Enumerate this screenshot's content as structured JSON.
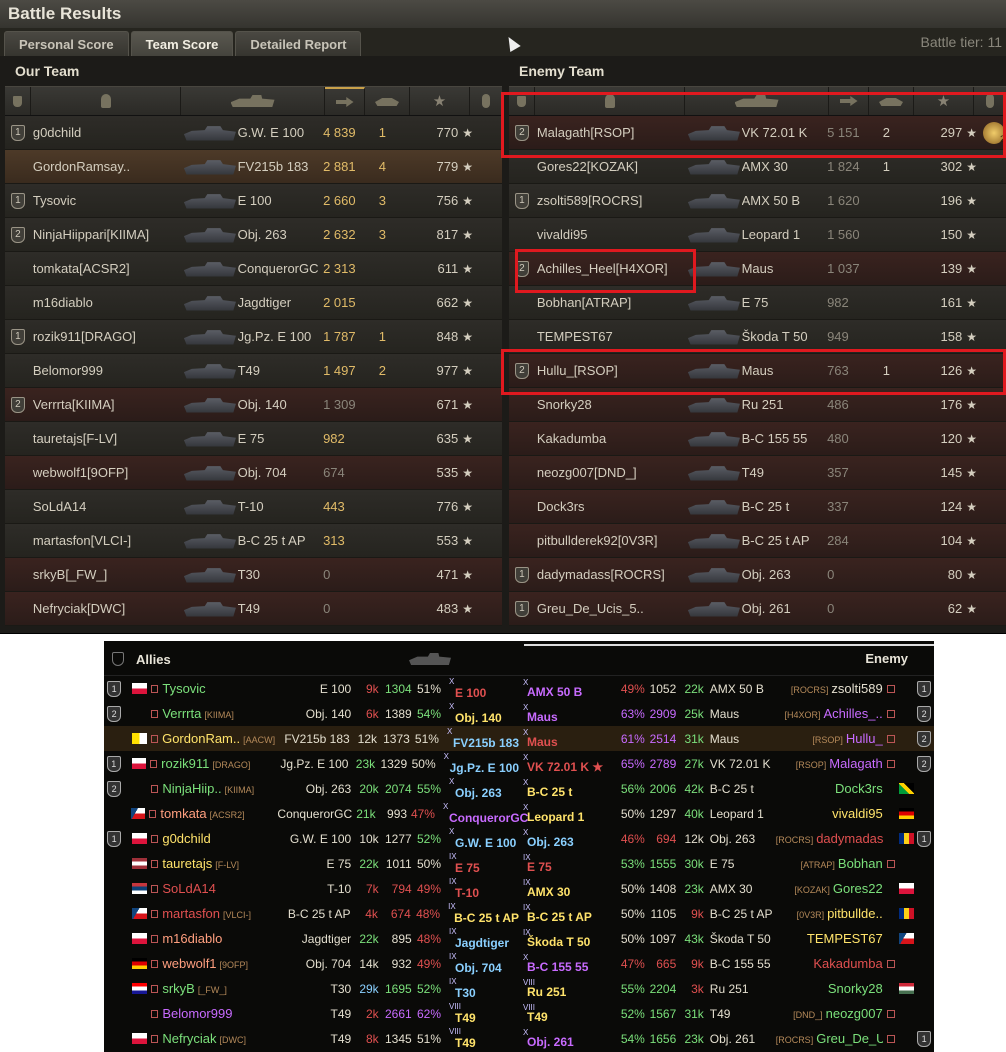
{
  "window": {
    "title": "Battle Results",
    "tier": "Battle tier: 11"
  },
  "tabs": [
    "Personal Score",
    "Team Score",
    "Detailed Report"
  ],
  "our_team": {
    "title": "Our Team",
    "players": [
      {
        "badge": "1",
        "name": "g0dchild",
        "tank": "G.W. E 100",
        "dmg": "4 839",
        "kills": "1",
        "xp": "770",
        "style": "normal",
        "dmgstyle": "gold"
      },
      {
        "badge": "",
        "name": "GordonRamsay..",
        "tank": "FV215b 183",
        "dmg": "2 881",
        "kills": "4",
        "xp": "779",
        "style": "self",
        "dmgstyle": "gold"
      },
      {
        "badge": "1",
        "name": "Tysovic",
        "tank": "E 100",
        "dmg": "2 660",
        "kills": "3",
        "xp": "756",
        "style": "normal",
        "dmgstyle": "gold"
      },
      {
        "badge": "2",
        "name": "NinjaHiippari[KIIMA]",
        "tank": "Obj. 263",
        "dmg": "2 632",
        "kills": "3",
        "xp": "817",
        "style": "normal",
        "dmgstyle": "gold"
      },
      {
        "badge": "",
        "name": "tomkata[ACSR2]",
        "tank": "ConquerorGC",
        "dmg": "2 313",
        "kills": "",
        "xp": "611",
        "style": "normal",
        "dmgstyle": "gold"
      },
      {
        "badge": "",
        "name": "m16diablo",
        "tank": "Jagdtiger",
        "dmg": "2 015",
        "kills": "",
        "xp": "662",
        "style": "normal",
        "dmgstyle": "gold"
      },
      {
        "badge": "1",
        "name": "rozik911[DRAGO]",
        "tank": "Jg.Pz. E 100",
        "dmg": "1 787",
        "kills": "1",
        "xp": "848",
        "style": "normal",
        "dmgstyle": "gold"
      },
      {
        "badge": "",
        "name": "Belomor999",
        "tank": "T49",
        "dmg": "1 497",
        "kills": "2",
        "xp": "977",
        "style": "normal",
        "dmgstyle": "gold"
      },
      {
        "badge": "2",
        "name": "Verrrta[KIIMA]",
        "tank": "Obj. 140",
        "dmg": "1 309",
        "kills": "",
        "xp": "671",
        "style": "dark",
        "dmgstyle": "gray"
      },
      {
        "badge": "",
        "name": "tauretajs[F-LV]",
        "tank": "E 75",
        "dmg": "982",
        "kills": "",
        "xp": "635",
        "style": "normal",
        "dmgstyle": "gold"
      },
      {
        "badge": "",
        "name": "webwolf1[9OFP]",
        "tank": "Obj. 704",
        "dmg": "674",
        "kills": "",
        "xp": "535",
        "style": "dark",
        "dmgstyle": "gray"
      },
      {
        "badge": "",
        "name": "SoLdA14",
        "tank": "T-10",
        "dmg": "443",
        "kills": "",
        "xp": "776",
        "style": "normal",
        "dmgstyle": "gold"
      },
      {
        "badge": "",
        "name": "martasfon[VLCI-]",
        "tank": "B-C 25 t AP",
        "dmg": "313",
        "kills": "",
        "xp": "553",
        "style": "normal",
        "dmgstyle": "gold"
      },
      {
        "badge": "",
        "name": "srkyB[_FW_]",
        "tank": "T30",
        "dmg": "0",
        "kills": "",
        "xp": "471",
        "style": "dark",
        "dmgstyle": "gray"
      },
      {
        "badge": "",
        "name": "Nefryciak[DWC]",
        "tank": "T49",
        "dmg": "0",
        "kills": "",
        "xp": "483",
        "style": "dark",
        "dmgstyle": "gray"
      }
    ]
  },
  "enemy_team": {
    "title": "Enemy Team",
    "players": [
      {
        "badge": "2",
        "name": "Malagath[RSOP]",
        "tank": "VK 72.01 K",
        "dmg": "5 151",
        "kills": "2",
        "xp": "297",
        "style": "dark",
        "medal": "2"
      },
      {
        "badge": "",
        "name": "Gores22[KOZAK]",
        "tank": "AMX 30",
        "dmg": "1 824",
        "kills": "1",
        "xp": "302",
        "style": "normal"
      },
      {
        "badge": "1",
        "name": "zsolti589[ROCRS]",
        "tank": "AMX 50 B",
        "dmg": "1 620",
        "kills": "",
        "xp": "196",
        "style": "normal"
      },
      {
        "badge": "",
        "name": "vivaldi95",
        "tank": "Leopard 1",
        "dmg": "1 560",
        "kills": "",
        "xp": "150",
        "style": "normal"
      },
      {
        "badge": "2",
        "name": "Achilles_Heel[H4XOR]",
        "tank": "Maus",
        "dmg": "1 037",
        "kills": "",
        "xp": "139",
        "style": "dark"
      },
      {
        "badge": "",
        "name": "Bobhan[ATRAP]",
        "tank": "E 75",
        "dmg": "982",
        "kills": "",
        "xp": "161",
        "style": "normal"
      },
      {
        "badge": "",
        "name": "TEMPEST67",
        "tank": "Škoda T 50",
        "dmg": "949",
        "kills": "",
        "xp": "158",
        "style": "normal"
      },
      {
        "badge": "2",
        "name": "Hullu_[RSOP]",
        "tank": "Maus",
        "dmg": "763",
        "kills": "1",
        "xp": "126",
        "style": "dark"
      },
      {
        "badge": "",
        "name": "Snorky28",
        "tank": "Ru 251",
        "dmg": "486",
        "kills": "",
        "xp": "176",
        "style": "dark"
      },
      {
        "badge": "",
        "name": "Kakadumba",
        "tank": "B-C 155 55",
        "dmg": "480",
        "kills": "",
        "xp": "120",
        "style": "dark"
      },
      {
        "badge": "",
        "name": "neozg007[DND_]",
        "tank": "T49",
        "dmg": "357",
        "kills": "",
        "xp": "145",
        "style": "dark"
      },
      {
        "badge": "",
        "name": "Dock3rs",
        "tank": "B-C 25 t",
        "dmg": "337",
        "kills": "",
        "xp": "124",
        "style": "dark"
      },
      {
        "badge": "",
        "name": "pitbullderek92[0V3R]",
        "tank": "B-C 25 t AP",
        "dmg": "284",
        "kills": "",
        "xp": "104",
        "style": "dark"
      },
      {
        "badge": "1",
        "name": "dadymadass[ROCRS]",
        "tank": "Obj. 263",
        "dmg": "0",
        "kills": "",
        "xp": "80",
        "style": "dark"
      },
      {
        "badge": "1",
        "name": "Greu_De_Ucis_5..",
        "tank": "Obj. 261",
        "dmg": "0",
        "kills": "",
        "xp": "62",
        "style": "dark"
      }
    ]
  },
  "xvm": {
    "allies_label": "Allies",
    "enemy_label": "Enemy",
    "rows": [
      {
        "lb": "1",
        "lflag": "pl",
        "lname": "Tysovic",
        "lclan": "",
        "lcolor": "#7be07b",
        "ltank": "E 100",
        "ldmg": "9k",
        "ldc": "#e05050",
        "lwn": "1304",
        "lwc": "#7be07b",
        "lpct": "51%",
        "lpc": "#e4dfcf",
        "ct": "X",
        "cl": "E 100",
        "clc": "#e05050",
        "crt": "X",
        "crl": "AMX 50 B",
        "crc": "#c86bff",
        "rpct": "49%",
        "rpc": "#e05050",
        "rwn": "1052",
        "rwc": "#e4dfcf",
        "rdmg": "22k",
        "rdc": "#7be07b",
        "rtank": "AMX 50 B",
        "rclan": "[ROCRS]",
        "rname": "zsolti589",
        "rcolor": "#e4dfcf",
        "rflag": "",
        "rb": "1"
      },
      {
        "lb": "2",
        "lflag": "",
        "lname": "Verrrta",
        "lclan": "[KIIMA]",
        "lcolor": "#7be07b",
        "ltank": "Obj. 140",
        "ldmg": "6k",
        "ldc": "#e05050",
        "lwn": "1389",
        "lwc": "#e4dfcf",
        "lpct": "54%",
        "lpc": "#7be07b",
        "ct": "X",
        "cl": "Obj. 140",
        "clc": "#ffe36b",
        "crt": "X",
        "crl": "Maus",
        "crc": "#c86bff",
        "rpct": "63%",
        "rpc": "#c86bff",
        "rwn": "2909",
        "rwc": "#c86bff",
        "rdmg": "25k",
        "rdc": "#7be07b",
        "rtank": "Maus",
        "rclan": "[H4XOR]",
        "rname": "Achilles_..",
        "rcolor": "#c86bff",
        "rflag": "",
        "rb": "2"
      },
      {
        "lb": "",
        "lflag": "va",
        "lname": "GordonRam..",
        "lclan": "[AACW]",
        "lcolor": "#ffe36b",
        "ltank": "FV215b 183",
        "ldmg": "12k",
        "ldc": "#e4dfcf",
        "lwn": "1373",
        "lwc": "#e4dfcf",
        "lpct": "51%",
        "lpc": "#e4dfcf",
        "ct": "X",
        "cl": "FV215b 183",
        "clc": "#8ad0ff",
        "crt": "X",
        "crl": "Maus",
        "crc": "#e05050",
        "rpct": "61%",
        "rpc": "#c86bff",
        "rwn": "2514",
        "rwc": "#c86bff",
        "rdmg": "31k",
        "rdc": "#7be07b",
        "rtank": "Maus",
        "rclan": "[RSOP]",
        "rname": "Hullu_",
        "rcolor": "#c86bff",
        "rflag": "",
        "rb": "2",
        "hl": true
      },
      {
        "lb": "1",
        "lflag": "pl",
        "lname": "rozik911",
        "lclan": "[DRAGO]",
        "lcolor": "#7be07b",
        "ltank": "Jg.Pz. E 100",
        "ldmg": "23k",
        "ldc": "#7be07b",
        "lwn": "1329",
        "lwc": "#e4dfcf",
        "lpct": "50%",
        "lpc": "#e4dfcf",
        "ct": "X",
        "cl": "Jg.Pz. E 100",
        "clc": "#8ad0ff",
        "crt": "X",
        "crl": "VK 72.01 K ★",
        "crc": "#e05050",
        "rpct": "65%",
        "rpc": "#c86bff",
        "rwn": "2789",
        "rwc": "#c86bff",
        "rdmg": "27k",
        "rdc": "#7be07b",
        "rtank": "VK 72.01 K",
        "rclan": "[RSOP]",
        "rname": "Malagath",
        "rcolor": "#c86bff",
        "rflag": "",
        "rb": "2"
      },
      {
        "lb": "2",
        "lflag": "",
        "lname": "NinjaHiip..",
        "lclan": "[KIIMA]",
        "lcolor": "#7be07b",
        "ltank": "Obj. 263",
        "ldmg": "20k",
        "ldc": "#7be07b",
        "lwn": "2074",
        "lwc": "#7be07b",
        "lpct": "55%",
        "lpc": "#7be07b",
        "ct": "X",
        "cl": "Obj. 263",
        "clc": "#8ad0ff",
        "crt": "X",
        "crl": "B-C 25 t",
        "crc": "#ffe36b",
        "rpct": "56%",
        "rpc": "#7be07b",
        "rwn": "2006",
        "rwc": "#7be07b",
        "rdmg": "42k",
        "rdc": "#7be07b",
        "rtank": "B-C 25 t",
        "rclan": "",
        "rname": "Dock3rs",
        "rcolor": "#7be07b",
        "rflag": "jm",
        "rb": ""
      },
      {
        "lb": "",
        "lflag": "cz",
        "lname": "tomkata",
        "lclan": "[ACSR2]",
        "lcolor": "#ff9f7f",
        "ltank": "ConquerorGC",
        "ldmg": "21k",
        "ldc": "#7be07b",
        "lwn": "993",
        "lwc": "#e4dfcf",
        "lpct": "47%",
        "lpc": "#e05050",
        "ct": "X",
        "cl": "ConquerorGC",
        "clc": "#c86bff",
        "crt": "X",
        "crl": "Leopard 1",
        "crc": "#ffe36b",
        "rpct": "50%",
        "rpc": "#e4dfcf",
        "rwn": "1297",
        "rwc": "#e4dfcf",
        "rdmg": "40k",
        "rdc": "#7be07b",
        "rtank": "Leopard 1",
        "rclan": "",
        "rname": "vivaldi95",
        "rcolor": "#ffe36b",
        "rflag": "de",
        "rb": ""
      },
      {
        "lb": "1",
        "lflag": "pl",
        "lname": "g0dchild",
        "lclan": "",
        "lcolor": "#ffe36b",
        "ltank": "G.W. E 100",
        "ldmg": "10k",
        "ldc": "#e4dfcf",
        "lwn": "1277",
        "lwc": "#e4dfcf",
        "lpct": "52%",
        "lpc": "#7be07b",
        "ct": "X",
        "cl": "G.W. E 100",
        "clc": "#8ad0ff",
        "crt": "X",
        "crl": "Obj. 263",
        "crc": "#8ad0ff",
        "rpct": "46%",
        "rpc": "#e05050",
        "rwn": "694",
        "rwc": "#e05050",
        "rdmg": "12k",
        "rdc": "#e4dfcf",
        "rtank": "Obj. 263",
        "rclan": "[ROCRS]",
        "rname": "dadymadass",
        "rcolor": "#e05050",
        "rflag": "ro",
        "rb": "1"
      },
      {
        "lb": "",
        "lflag": "lv",
        "lname": "tauretajs",
        "lclan": "[F-LV]",
        "lcolor": "#ffe36b",
        "ltank": "E 75",
        "ldmg": "22k",
        "ldc": "#7be07b",
        "lwn": "1011",
        "lwc": "#e4dfcf",
        "lpct": "50%",
        "lpc": "#e4dfcf",
        "ct": "IX",
        "cl": "E 75",
        "clc": "#e05050",
        "crt": "IX",
        "crl": "E 75",
        "crc": "#e05050",
        "rpct": "53%",
        "rpc": "#7be07b",
        "rwn": "1555",
        "rwc": "#7be07b",
        "rdmg": "30k",
        "rdc": "#7be07b",
        "rtank": "E 75",
        "rclan": "[ATRAP]",
        "rname": "Bobhan",
        "rcolor": "#7be07b",
        "rflag": "",
        "rb": ""
      },
      {
        "lb": "",
        "lflag": "rs",
        "lname": "SoLdA14",
        "lclan": "",
        "lcolor": "#e05050",
        "ltank": "T-10",
        "ldmg": "7k",
        "ldc": "#e05050",
        "lwn": "794",
        "lwc": "#e05050",
        "lpct": "49%",
        "lpc": "#e05050",
        "ct": "IX",
        "cl": "T-10",
        "clc": "#e05050",
        "crt": "IX",
        "crl": "AMX 30",
        "crc": "#ffe36b",
        "rpct": "50%",
        "rpc": "#e4dfcf",
        "rwn": "1408",
        "rwc": "#e4dfcf",
        "rdmg": "23k",
        "rdc": "#7be07b",
        "rtank": "AMX 30",
        "rclan": "[KOZAK]",
        "rname": "Gores22",
        "rcolor": "#7be07b",
        "rflag": "pl",
        "rb": ""
      },
      {
        "lb": "",
        "lflag": "cz",
        "lname": "martasfon",
        "lclan": "[VLCI-]",
        "lcolor": "#e05050",
        "ltank": "B-C 25 t AP",
        "ldmg": "4k",
        "ldc": "#e05050",
        "lwn": "674",
        "lwc": "#e05050",
        "lpct": "48%",
        "lpc": "#e05050",
        "ct": "IX",
        "cl": "B-C 25 t AP",
        "clc": "#ffe36b",
        "crt": "IX",
        "crl": "B-C 25 t AP",
        "crc": "#ffe36b",
        "rpct": "50%",
        "rpc": "#e4dfcf",
        "rwn": "1105",
        "rwc": "#e4dfcf",
        "rdmg": "9k",
        "rdc": "#e05050",
        "rtank": "B-C 25 t AP",
        "rclan": "[0V3R]",
        "rname": "pitbullde..",
        "rcolor": "#ffe36b",
        "rflag": "ro",
        "rb": ""
      },
      {
        "lb": "",
        "lflag": "pl",
        "lname": "m16diablo",
        "lclan": "",
        "lcolor": "#ff9f7f",
        "ltank": "Jagdtiger",
        "ldmg": "22k",
        "ldc": "#7be07b",
        "lwn": "895",
        "lwc": "#e4dfcf",
        "lpct": "48%",
        "lpc": "#e05050",
        "ct": "IX",
        "cl": "Jagdtiger",
        "clc": "#8ad0ff",
        "crt": "IX",
        "crl": "Škoda T 50",
        "crc": "#ffe36b",
        "rpct": "50%",
        "rpc": "#e4dfcf",
        "rwn": "1097",
        "rwc": "#e4dfcf",
        "rdmg": "43k",
        "rdc": "#7be07b",
        "rtank": "Škoda T 50",
        "rclan": "",
        "rname": "TEMPEST67",
        "rcolor": "#ffe36b",
        "rflag": "cz",
        "rb": ""
      },
      {
        "lb": "",
        "lflag": "de",
        "lname": "webwolf1",
        "lclan": "[9OFP]",
        "lcolor": "#ff9f7f",
        "ltank": "Obj. 704",
        "ldmg": "14k",
        "ldc": "#e4dfcf",
        "lwn": "932",
        "lwc": "#e4dfcf",
        "lpct": "49%",
        "lpc": "#e05050",
        "ct": "IX",
        "cl": "Obj. 704",
        "clc": "#8ad0ff",
        "crt": "X",
        "crl": "B-C 155 55",
        "crc": "#c86bff",
        "rpct": "47%",
        "rpc": "#e05050",
        "rwn": "665",
        "rwc": "#e05050",
        "rdmg": "9k",
        "rdc": "#e05050",
        "rtank": "B-C 155 55",
        "rclan": "",
        "rname": "Kakadumba",
        "rcolor": "#e05050",
        "rflag": "",
        "rb": ""
      },
      {
        "lb": "",
        "lflag": "hr",
        "lname": "srkyB",
        "lclan": "[_FW_]",
        "lcolor": "#7be07b",
        "ltank": "T30",
        "ldmg": "29k",
        "ldc": "#8ad0ff",
        "lwn": "1695",
        "lwc": "#7be07b",
        "lpct": "52%",
        "lpc": "#7be07b",
        "ct": "IX",
        "cl": "T30",
        "clc": "#8ad0ff",
        "crt": "VIII",
        "crl": "Ru 251",
        "crc": "#ffe36b",
        "rpct": "55%",
        "rpc": "#7be07b",
        "rwn": "2204",
        "rwc": "#7be07b",
        "rdmg": "3k",
        "rdc": "#e05050",
        "rtank": "Ru 251",
        "rclan": "",
        "rname": "Snorky28",
        "rcolor": "#7be07b",
        "rflag": "hu",
        "rb": ""
      },
      {
        "lb": "",
        "lflag": "",
        "lname": "Belomor999",
        "lclan": "",
        "lcolor": "#c86bff",
        "ltank": "T49",
        "ldmg": "2k",
        "ldc": "#e05050",
        "lwn": "2661",
        "lwc": "#c86bff",
        "lpct": "62%",
        "lpc": "#c86bff",
        "ct": "VIII",
        "cl": "T49",
        "clc": "#ffe36b",
        "crt": "VIII",
        "crl": "T49",
        "crc": "#ffe36b",
        "rpct": "52%",
        "rpc": "#7be07b",
        "rwn": "1567",
        "rwc": "#7be07b",
        "rdmg": "31k",
        "rdc": "#7be07b",
        "rtank": "T49",
        "rclan": "[DND_]",
        "rname": "neozg007",
        "rcolor": "#7be07b",
        "rflag": "",
        "rb": ""
      },
      {
        "lb": "",
        "lflag": "pl",
        "lname": "Nefryciak",
        "lclan": "[DWC]",
        "lcolor": "#7be07b",
        "ltank": "T49",
        "ldmg": "8k",
        "ldc": "#e05050",
        "lwn": "1345",
        "lwc": "#e4dfcf",
        "lpct": "51%",
        "lpc": "#e4dfcf",
        "ct": "VIII",
        "cl": "T49",
        "clc": "#ffe36b",
        "crt": "X",
        "crl": "Obj. 261",
        "crc": "#c86bff",
        "rpct": "54%",
        "rpc": "#7be07b",
        "rwn": "1656",
        "rwc": "#7be07b",
        "rdmg": "23k",
        "rdc": "#7be07b",
        "rtank": "Obj. 261",
        "rclan": "[ROCRS]",
        "rname": "Greu_De_U..",
        "rcolor": "#7be07b",
        "rflag": "",
        "rb": "1"
      }
    ]
  }
}
